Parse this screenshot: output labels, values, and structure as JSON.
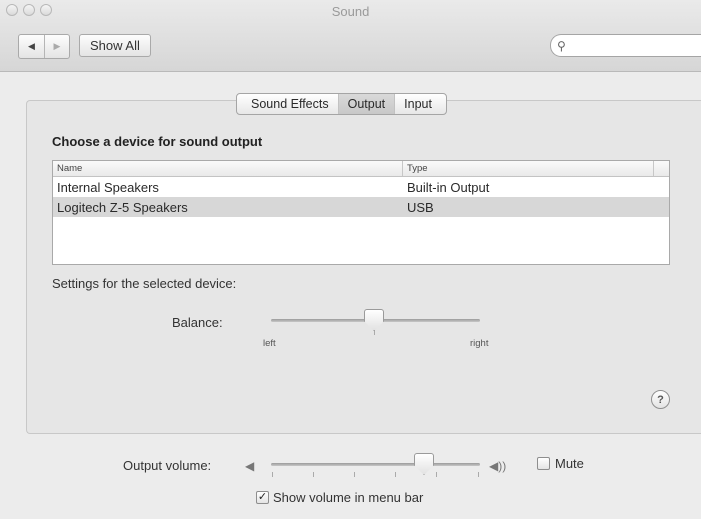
{
  "window": {
    "title": "Sound"
  },
  "toolbar": {
    "back_glyph": "◀",
    "forward_glyph": "▶",
    "show_all": "Show All",
    "search_glyph": "⚲",
    "search_value": ""
  },
  "tabs": [
    {
      "label": "Sound Effects",
      "active": false
    },
    {
      "label": "Output",
      "active": true
    },
    {
      "label": "Input",
      "active": false
    }
  ],
  "output": {
    "heading": "Choose a device for sound output",
    "columns": {
      "name": "Name",
      "type": "Type"
    },
    "devices": [
      {
        "name": "Internal Speakers",
        "type": "Built-in Output",
        "selected": false
      },
      {
        "name": "Logitech Z-5 Speakers",
        "type": "USB",
        "selected": true
      }
    ],
    "settings_label": "Settings for the selected device:",
    "balance": {
      "label": "Balance:",
      "left": "left",
      "right": "right",
      "value": 0.45
    }
  },
  "help": {
    "glyph": "?"
  },
  "volume": {
    "label": "Output volume:",
    "low_icon": "speaker-low-icon",
    "low_glyph": "◀",
    "high_icon": "speaker-high-icon",
    "high_glyph": "◀))",
    "value": 0.7,
    "mute_label": "Mute",
    "mute_checked": false,
    "show_in_menu_bar_label": "Show volume in menu bar",
    "show_in_menu_bar_checked": true,
    "check_glyph": "✓"
  }
}
